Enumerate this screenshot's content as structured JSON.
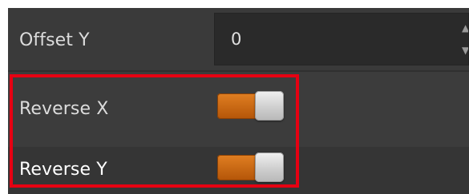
{
  "properties": {
    "offset_y": {
      "label": "Offset Y",
      "value": "0"
    },
    "reverse_x": {
      "label": "Reverse X",
      "state": "on"
    },
    "reverse_y": {
      "label": "Reverse Y",
      "state": "on"
    }
  },
  "colors": {
    "toggle_on": "#d9731a",
    "highlight_box": "#e60012",
    "panel_bg": "#3a3a3a"
  },
  "icons": {
    "spin_up": "▲",
    "spin_down": "▼"
  }
}
